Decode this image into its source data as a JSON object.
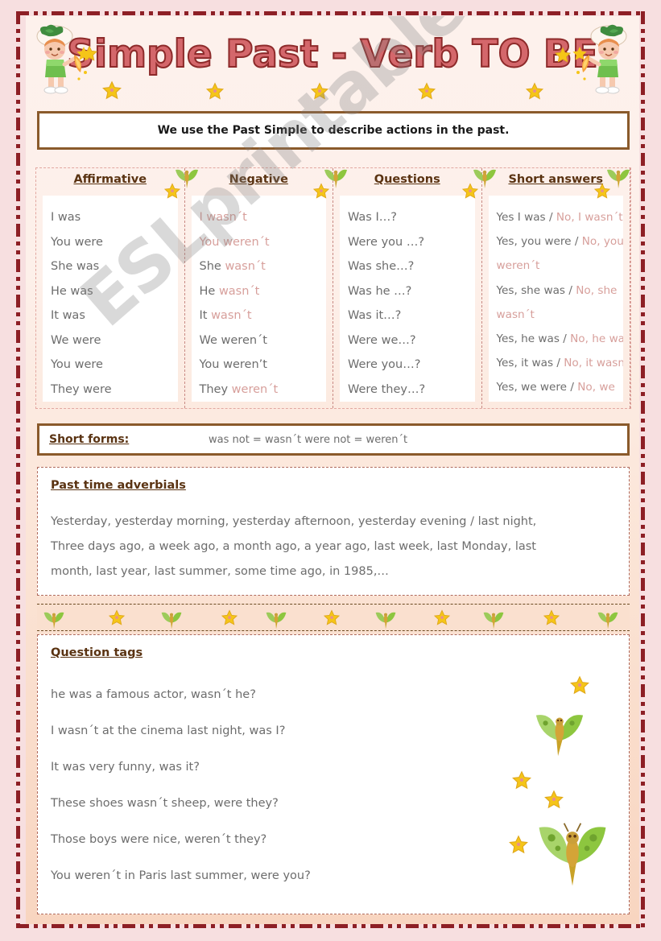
{
  "title": "Simple Past - Verb TO BE",
  "intro": "We use the Past Simple to describe actions in the past.",
  "table": {
    "columns": [
      {
        "header": "Affirmative",
        "lines": [
          [
            {
              "t": "I was",
              "c": "gray"
            }
          ],
          [
            {
              "t": "You were",
              "c": "gray"
            }
          ],
          [
            {
              "t": "She was",
              "c": "gray"
            }
          ],
          [
            {
              "t": "He was",
              "c": "gray"
            }
          ],
          [
            {
              "t": "It was",
              "c": "gray"
            }
          ],
          [
            {
              "t": "We were",
              "c": "gray"
            }
          ],
          [
            {
              "t": "You were",
              "c": "gray"
            }
          ],
          [
            {
              "t": "They were",
              "c": "gray"
            }
          ]
        ]
      },
      {
        "header": "Negative",
        "lines": [
          [
            {
              "t": "I wasn´t",
              "c": "pink"
            }
          ],
          [
            {
              "t": "You weren´t",
              "c": "pink"
            }
          ],
          [
            {
              "t": "She ",
              "c": "gray"
            },
            {
              "t": "wasn´t",
              "c": "pink"
            }
          ],
          [
            {
              "t": "He ",
              "c": "gray"
            },
            {
              "t": "wasn´t",
              "c": "pink"
            }
          ],
          [
            {
              "t": " It ",
              "c": "gray"
            },
            {
              "t": "wasn´t",
              "c": "pink"
            }
          ],
          [
            {
              "t": "We weren´t",
              "c": "gray"
            }
          ],
          [
            {
              "t": "You weren’t",
              "c": "gray"
            }
          ],
          [
            {
              "t": "They ",
              "c": "gray"
            },
            {
              "t": "weren´t",
              "c": "pink"
            }
          ]
        ]
      },
      {
        "header": "Questions",
        "lines": [
          [
            {
              "t": "Was I…?",
              "c": "gray"
            }
          ],
          [
            {
              "t": "Were you …?",
              "c": "gray"
            }
          ],
          [
            {
              "t": "Was she…?",
              "c": "gray"
            }
          ],
          [
            {
              "t": "Was he …?",
              "c": "gray"
            }
          ],
          [
            {
              "t": "Was it…?",
              "c": "gray"
            }
          ],
          [
            {
              "t": "Were we…?",
              "c": "gray"
            }
          ],
          [
            {
              "t": " Were you…?",
              "c": "gray"
            }
          ],
          [
            {
              "t": "Were they…?",
              "c": "gray"
            }
          ]
        ]
      },
      {
        "header": "Short answers",
        "lines": [
          [
            {
              "t": "Yes I was / ",
              "c": "gray"
            },
            {
              "t": "No, I wasn´t",
              "c": "pink"
            }
          ],
          [
            {
              "t": "Yes, you were / ",
              "c": "gray"
            },
            {
              "t": "No, you",
              "c": "pink"
            }
          ],
          [
            {
              "t": "weren´t",
              "c": "pink"
            }
          ],
          [
            {
              "t": "Yes, she was / ",
              "c": "gray"
            },
            {
              "t": "No, she",
              "c": "pink"
            }
          ],
          [
            {
              "t": "wasn´t",
              "c": "pink"
            }
          ],
          [
            {
              "t": "Yes, he was / ",
              "c": "gray"
            },
            {
              "t": "No, he wasn´t",
              "c": "pink"
            }
          ],
          [
            {
              "t": "Yes, it was / ",
              "c": "gray"
            },
            {
              "t": "No, it wasn´t",
              "c": "pink"
            }
          ],
          [
            {
              "t": "Yes, we were / ",
              "c": "gray"
            },
            {
              "t": "No, we",
              "c": "pink"
            }
          ]
        ]
      }
    ]
  },
  "short_forms": {
    "label": "Short forms:",
    "value": "was not  = wasn´t    were not = weren´t"
  },
  "adverbials": {
    "header": "Past time adverbials",
    "lines": [
      "Yesterday,  yesterday morning, yesterday afternoon, yesterday evening / last night,",
      "Three days ago, a week ago, a month ago, a year ago, last week, last Monday, last",
      "month, last year, last summer, some time ago, in 1985,…"
    ]
  },
  "question_tags": {
    "header": "Question tags",
    "lines": [
      "he was a famous actor, wasn´t he?",
      "I wasn´t at the cinema last night, was I?",
      "It was very funny, was it?",
      "These shoes wasn´t sheep, were they?",
      "Those boys were nice, weren´t they?",
      "You weren´t in Paris last summer, were you?"
    ]
  },
  "watermark": "ESLprintables.com",
  "colors": {
    "page_bg": "#f7dfe0",
    "frame": "#8d1f25",
    "title": "#d4676b",
    "title_outline": "#8d2a2a",
    "box_border": "#8a5a2b",
    "heading": "#5a3312",
    "body_text": "#6d6d6d",
    "pink_text": "#d79f9b",
    "band_bg": "#fae0cf",
    "star": "#f5c518",
    "butterfly": "#8dc63f"
  }
}
